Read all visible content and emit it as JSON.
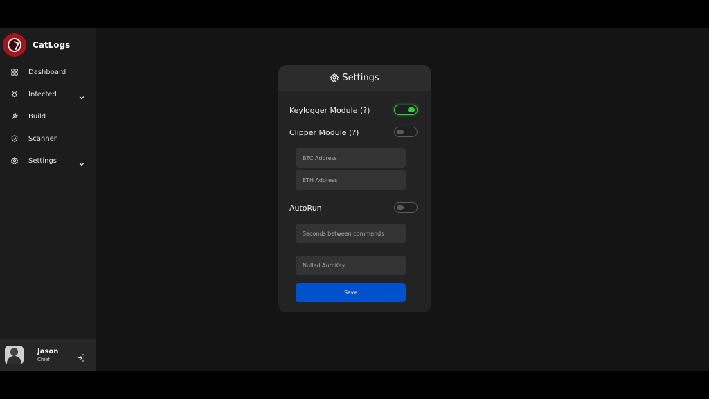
{
  "app": {
    "name": "CatLogs",
    "accent": "#0052cc",
    "brand_color": "#a3151b",
    "toggle_on_color": "#36c940"
  },
  "sidebar": {
    "items": [
      {
        "label": "Dashboard",
        "icon": "grid-icon",
        "has_submenu": false
      },
      {
        "label": "Infected",
        "icon": "bug-icon",
        "has_submenu": true
      },
      {
        "label": "Build",
        "icon": "wrench-icon",
        "has_submenu": false
      },
      {
        "label": "Scanner",
        "icon": "shield-check-icon",
        "has_submenu": false
      },
      {
        "label": "Settings",
        "icon": "gear-icon",
        "has_submenu": true
      }
    ]
  },
  "user": {
    "name": "Jason",
    "role": "Chief",
    "logout_icon": "logout-icon"
  },
  "settings": {
    "title": "Settings",
    "keylogger": {
      "label": "Keylogger Module (?)",
      "enabled": true
    },
    "clipper": {
      "label": "Clipper Module (?)",
      "enabled": false
    },
    "btc": {
      "placeholder": "BTC Address",
      "value": ""
    },
    "eth": {
      "placeholder": "ETH Address",
      "value": ""
    },
    "autorun": {
      "label": "AutoRun",
      "enabled": false
    },
    "seconds": {
      "placeholder": "Seconds between commands",
      "value": ""
    },
    "authkey": {
      "placeholder": "Nulled AuthKey",
      "value": ""
    },
    "save_label": "Save"
  }
}
